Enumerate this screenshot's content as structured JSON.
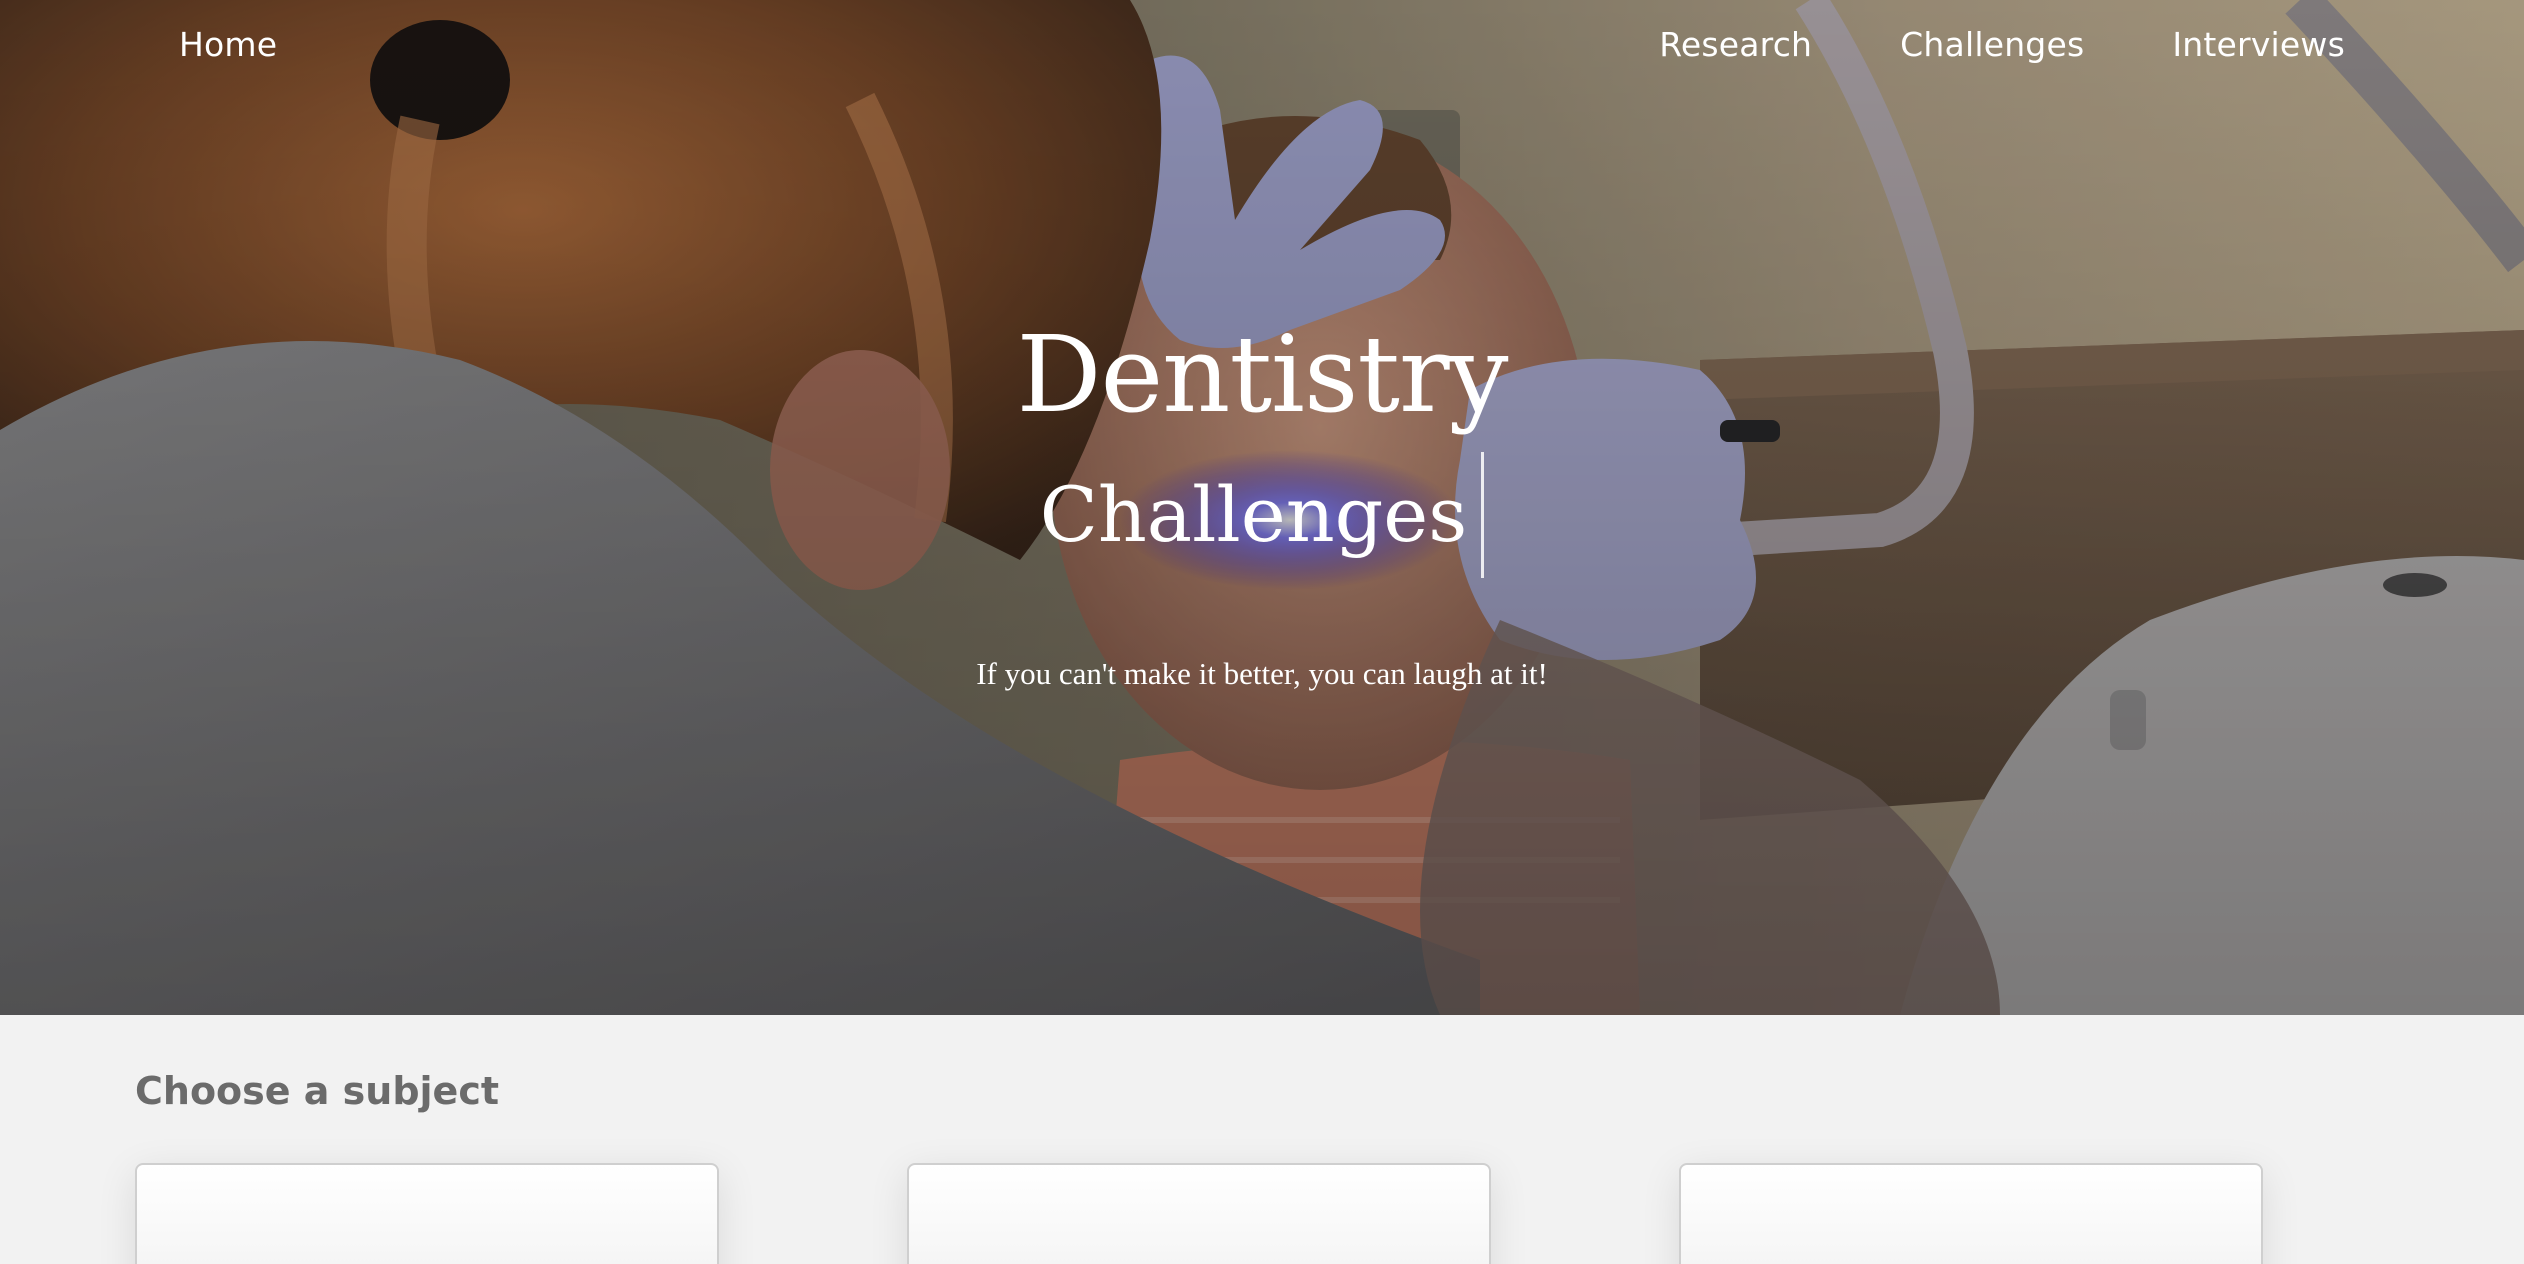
{
  "nav": {
    "home": "Home",
    "links": [
      "Research",
      "Challenges",
      "Interviews"
    ]
  },
  "hero": {
    "title": "Dentistry",
    "subtitle": "Challenges",
    "tagline": "If you can't make it better, you can laugh at it!"
  },
  "subjects": {
    "heading": "Choose a subject"
  },
  "colors": {
    "hero_text": "#ffffff",
    "page_background": "#f2f2f2",
    "heading_text": "#6b6b6b",
    "card_border": "#cfcfcf"
  }
}
